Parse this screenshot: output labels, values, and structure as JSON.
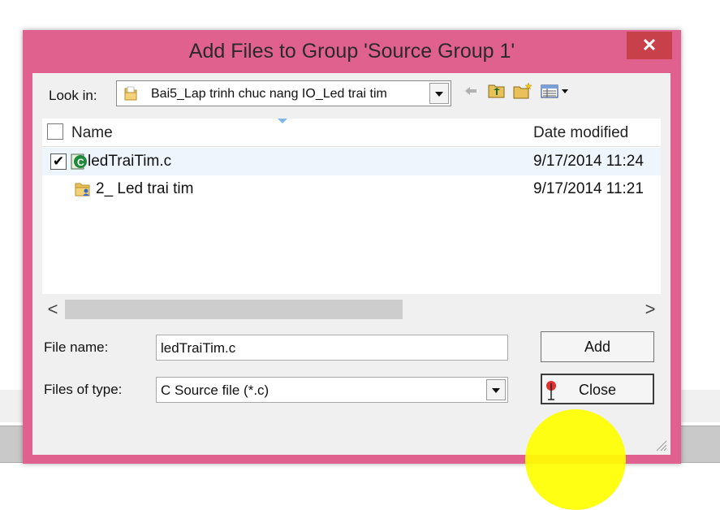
{
  "dialog": {
    "title": "Add Files to Group 'Source Group 1'",
    "close_glyph": "✕",
    "accent_color": "#e0608e"
  },
  "lookin": {
    "label": "Look in:",
    "value": "Bai5_Lap trinh chuc nang IO_Led trai tim",
    "icon": "folder-icon"
  },
  "toolbar": {
    "icons": [
      "back-arrow-icon",
      "up-folder-icon",
      "new-folder-icon",
      "view-menu-icon"
    ]
  },
  "filelist": {
    "columns": [
      "Name",
      "Date modified"
    ],
    "rows": [
      {
        "name": "ledTraiTim.c",
        "date": "9/17/2014 11:24",
        "checked": true,
        "icon": "c-source-file-icon"
      },
      {
        "name": "2_ Led trai tim",
        "date": "9/17/2014 11:21",
        "checked": false,
        "icon": "folder-icon"
      }
    ]
  },
  "scroll": {
    "left_glyph": "<",
    "right_glyph": ">"
  },
  "file_name": {
    "label": "File name:",
    "value": "ledTraiTim.c"
  },
  "file_type": {
    "label": "Files of type:",
    "value": "C Source file (*.c)"
  },
  "buttons": {
    "add": "Add",
    "close": "Close"
  }
}
